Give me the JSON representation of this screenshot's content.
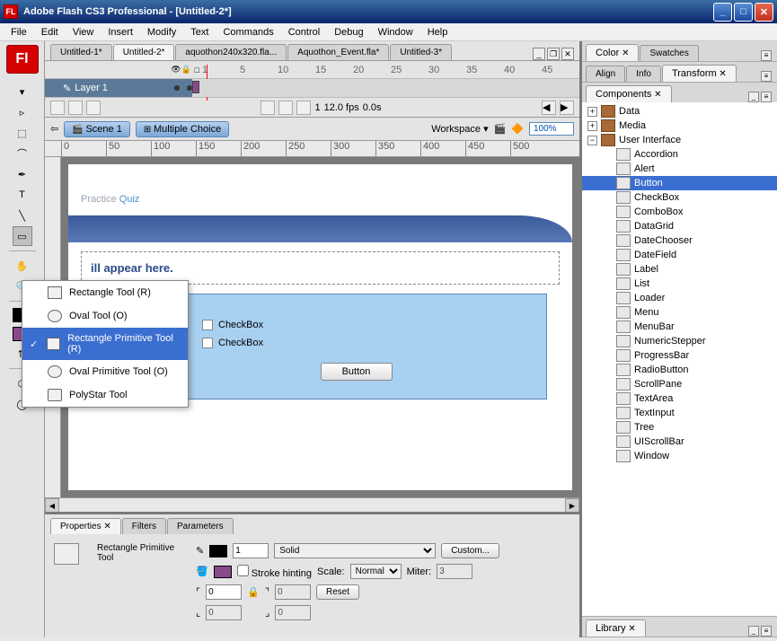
{
  "titlebar": {
    "app_icon": "FL",
    "title": "Adobe Flash CS3 Professional - [Untitled-2*]"
  },
  "menubar": [
    "File",
    "Edit",
    "View",
    "Insert",
    "Modify",
    "Text",
    "Commands",
    "Control",
    "Debug",
    "Window",
    "Help"
  ],
  "doctabs": [
    {
      "label": "Untitled-1*",
      "active": false
    },
    {
      "label": "Untitled-2*",
      "active": true
    },
    {
      "label": "aquothon240x320.fla...",
      "active": false
    },
    {
      "label": "Aquothon_Event.fla*",
      "active": false
    },
    {
      "label": "Untitled-3*",
      "active": false
    }
  ],
  "timeline": {
    "layer_name": "Layer 1",
    "frame_marks": [
      "1",
      "5",
      "10",
      "15",
      "20",
      "25",
      "30",
      "35",
      "40",
      "45"
    ],
    "footer": {
      "frame": "1",
      "fps": "12.0 fps",
      "time": "0.0s"
    }
  },
  "scenebar": {
    "scene": "Scene 1",
    "crumb": "Multiple Choice",
    "workspace": "Workspace",
    "zoom": "100%"
  },
  "ruler_marks": [
    "0",
    "50",
    "100",
    "150",
    "200",
    "250",
    "300",
    "350",
    "400",
    "450",
    "500"
  ],
  "stage": {
    "title_a": "Practice ",
    "title_b": "Quiz",
    "question": "ill appear here.",
    "check1": "CheckBox",
    "check2": "CheckBox",
    "button": "Button"
  },
  "flyout": [
    {
      "label": "Rectangle Tool (R)",
      "shape": "rect",
      "sel": false
    },
    {
      "label": "Oval Tool (O)",
      "shape": "oval",
      "sel": false
    },
    {
      "label": "Rectangle Primitive Tool (R)",
      "shape": "rect",
      "sel": true
    },
    {
      "label": "Oval Primitive Tool (O)",
      "shape": "oval",
      "sel": false
    },
    {
      "label": "PolyStar Tool",
      "shape": "poly",
      "sel": false
    }
  ],
  "props": {
    "tabs": [
      "Properties",
      "Filters",
      "Parameters"
    ],
    "tool_name": "Rectangle Primitive Tool",
    "stroke_width": "1",
    "stroke_style": "Solid",
    "custom": "Custom...",
    "hinting": "Stroke hinting",
    "scale_label": "Scale:",
    "scale_value": "Normal",
    "miter_label": "Miter:",
    "miter_value": "3",
    "corner_a": "0",
    "corner_b": "0",
    "corner_c": "0",
    "corner_d": "0",
    "reset": "Reset"
  },
  "right": {
    "color_tabs": [
      "Color",
      "Swatches"
    ],
    "align_tabs": [
      "Align",
      "Info",
      "Transform"
    ],
    "components_tab": "Components",
    "library_tab": "Library",
    "tree": {
      "data": "Data",
      "media": "Media",
      "ui": "User Interface",
      "items": [
        "Accordion",
        "Alert",
        "Button",
        "CheckBox",
        "ComboBox",
        "DataGrid",
        "DateChooser",
        "DateField",
        "Label",
        "List",
        "Loader",
        "Menu",
        "MenuBar",
        "NumericStepper",
        "ProgressBar",
        "RadioButton",
        "ScrollPane",
        "TextArea",
        "TextInput",
        "Tree",
        "UIScrollBar",
        "Window"
      ],
      "selected": "Button"
    }
  }
}
